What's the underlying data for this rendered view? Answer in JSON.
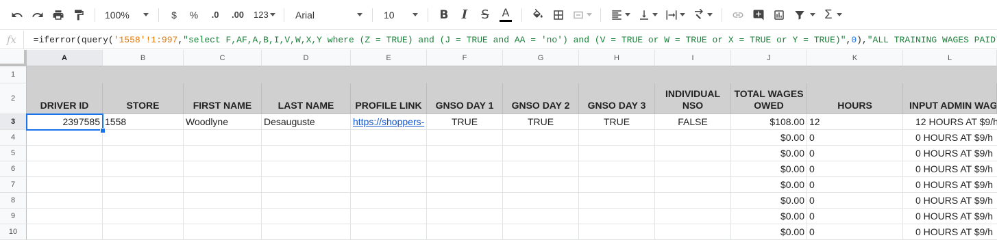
{
  "toolbar": {
    "zoom": "100%",
    "currency": "$",
    "percent": "%",
    "decrease_decimal": ".0",
    "increase_decimal": ".00",
    "more_formats": "123",
    "font": "Arial",
    "font_size": "10",
    "bold": "B",
    "italic": "I",
    "strike": "S",
    "text_color": "A"
  },
  "formula_bar": {
    "fx": "fx",
    "p1": "=iferror(query(",
    "p2": "'1558'!1:997",
    "p3": ",",
    "p4": "\"select F,AF,A,B,I,V,W,X,Y where (Z = TRUE) and (J = TRUE and AA = 'no') and (V = TRUE or W = TRUE or X = TRUE or Y = TRUE)\"",
    "p5": ",",
    "p6": "0",
    "p7": "),",
    "p8": "\"ALL TRAINING WAGES PAID\"",
    "p9": ")"
  },
  "columns": [
    "A",
    "B",
    "C",
    "D",
    "E",
    "F",
    "G",
    "H",
    "I",
    "J",
    "K",
    "L"
  ],
  "rows": [
    "1",
    "2",
    "3",
    "4",
    "5",
    "6",
    "7",
    "8",
    "9",
    "10"
  ],
  "headers": [
    "DRIVER ID",
    "STORE",
    "FIRST NAME",
    "LAST NAME",
    "PROFILE LINK",
    "GNSO DAY 1",
    "GNSO DAY 2",
    "GNSO DAY 3",
    "INDIVIDUAL NSO",
    "TOTAL WAGES OWED",
    "HOURS",
    "INPUT ADMIN WAG"
  ],
  "data_row": {
    "driver_id": "2397585",
    "store": "1558",
    "first_name": "Woodlyne",
    "last_name": "Desauguste",
    "profile_link": "https://shoppers-",
    "gnso1": "TRUE",
    "gnso2": "TRUE",
    "gnso3": "TRUE",
    "nso": "FALSE",
    "wages": "$108.00",
    "hours": "12",
    "admin": "12 HOURS AT $9/h"
  },
  "empty_rows": [
    {
      "wages": "$0.00",
      "hours": "0",
      "admin": "0 HOURS AT $9/h"
    },
    {
      "wages": "$0.00",
      "hours": "0",
      "admin": "0 HOURS AT $9/h"
    },
    {
      "wages": "$0.00",
      "hours": "0",
      "admin": "0 HOURS AT $9/h"
    },
    {
      "wages": "$0.00",
      "hours": "0",
      "admin": "0 HOURS AT $9/h"
    },
    {
      "wages": "$0.00",
      "hours": "0",
      "admin": "0 HOURS AT $9/h"
    },
    {
      "wages": "$0.00",
      "hours": "0",
      "admin": "0 HOURS AT $9/h"
    },
    {
      "wages": "$0.00",
      "hours": "0",
      "admin": "0 HOURS AT $9/h"
    }
  ],
  "colors": {
    "accent": "#1a73e8",
    "header_fill": "#d0d0d0",
    "link": "#1155cc"
  }
}
